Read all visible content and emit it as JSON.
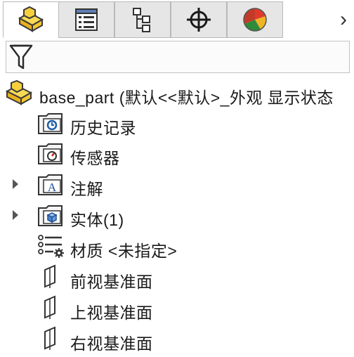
{
  "tabs": [
    {
      "name": "featuremanager",
      "icon": "part-feature-tree-icon",
      "active": true
    },
    {
      "name": "propertymanager",
      "icon": "property-list-icon",
      "active": false
    },
    {
      "name": "configurationmanager",
      "icon": "configuration-tree-icon",
      "active": false
    },
    {
      "name": "dimxpertmanager",
      "icon": "crosshair-target-icon",
      "active": false
    },
    {
      "name": "displaymanager",
      "icon": "color-pie-icon",
      "active": false
    }
  ],
  "more_tabs_glyph": "›",
  "filter": {
    "icon": "filter-funnel-icon"
  },
  "tree": {
    "root": {
      "label": "base_part  (默认<<默认>_外观 显示状态",
      "icon": "part-icon"
    },
    "items": [
      {
        "label": "历史记录",
        "icon": "history-folder-icon",
        "expandable": false
      },
      {
        "label": "传感器",
        "icon": "sensor-folder-icon",
        "expandable": false
      },
      {
        "label": "注解",
        "icon": "annotation-folder-icon",
        "expandable": true
      },
      {
        "label": "实体(1)",
        "icon": "solid-bodies-folder-icon",
        "expandable": true
      },
      {
        "label": "材质 <未指定>",
        "icon": "material-icon",
        "expandable": false
      },
      {
        "label": "前视基准面",
        "icon": "plane-icon",
        "expandable": false
      },
      {
        "label": "上视基准面",
        "icon": "plane-icon",
        "expandable": false
      },
      {
        "label": "右视基准面",
        "icon": "plane-icon",
        "expandable": false
      }
    ]
  },
  "colors": {
    "part_yellow": "#f2c530",
    "tab_inactive": "#e6e6e6",
    "tab_border": "#b9b9b9"
  }
}
